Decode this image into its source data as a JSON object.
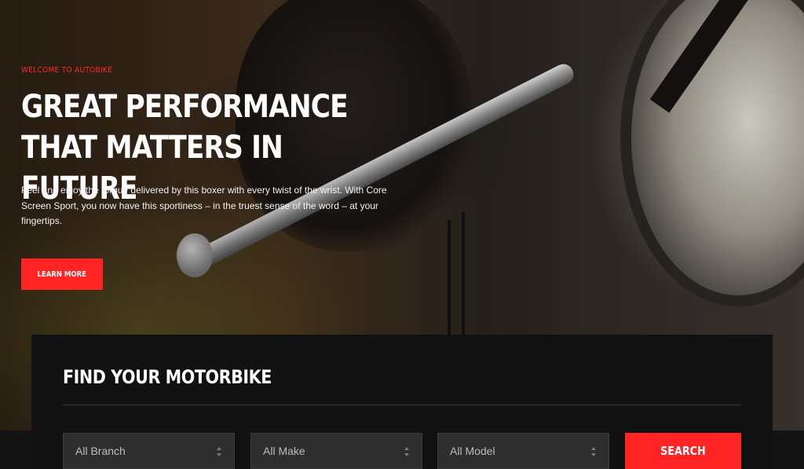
{
  "hero": {
    "eyebrow": "WELCOME TO AUTOBIKE",
    "headline_line1": "GREAT PERFORMANCE",
    "headline_line2": "THAT MATTERS IN FUTURE",
    "intro": "Feel and enjoy the torque delivered by this boxer with every twist of the wrist. With Core Screen Sport, you now have this sportiness – in the truest sense of the word – at your fingertips.",
    "cta_label": "LEARN MORE"
  },
  "finder": {
    "title": "FIND YOUR MOTORBIKE",
    "selects": [
      {
        "value": "All Branch"
      },
      {
        "value": "All Make"
      },
      {
        "value": "All Model"
      }
    ],
    "search_label": "SEARCH"
  },
  "colors": {
    "accent": "#ff2323",
    "panel": "#111111",
    "select_bg": "#2e2e2e"
  },
  "icons": {
    "select_arrow": "up-down-arrows-icon"
  }
}
